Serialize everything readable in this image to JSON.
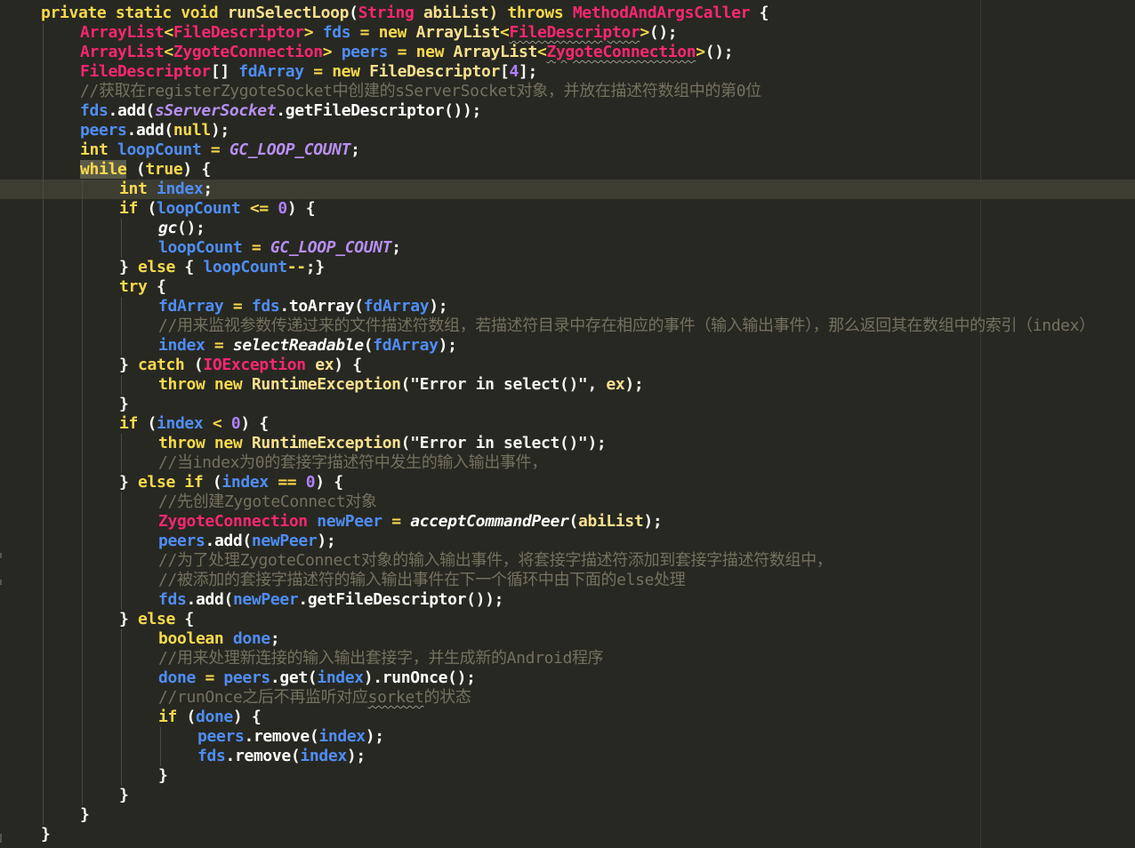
{
  "editor": {
    "current_line_index": 9,
    "lines": [
      {
        "indent": 1,
        "tokens": [
          {
            "t": "private static void ",
            "c": "kw"
          },
          {
            "t": "runSelectLoop",
            "c": "cl"
          },
          {
            "t": "(",
            "c": "pu"
          },
          {
            "t": "String",
            "c": "ty"
          },
          {
            "t": " abiList) ",
            "c": "cl"
          },
          {
            "t": "throws",
            "c": "kw"
          },
          {
            "t": " ",
            "c": "pu"
          },
          {
            "t": "MethodAndArgsCaller",
            "c": "ty"
          },
          {
            "t": " {",
            "c": "pu"
          }
        ]
      },
      {
        "indent": 2,
        "tokens": [
          {
            "t": "ArrayList",
            "c": "ty"
          },
          {
            "t": "<",
            "c": "op"
          },
          {
            "t": "FileDescriptor",
            "c": "ty"
          },
          {
            "t": ">",
            "c": "op"
          },
          {
            "t": " ",
            "c": "pu"
          },
          {
            "t": "fds",
            "c": "va"
          },
          {
            "t": " = ",
            "c": "op"
          },
          {
            "t": "new ",
            "c": "kw"
          },
          {
            "t": "ArrayList",
            "c": "cl"
          },
          {
            "t": "<",
            "c": "op"
          },
          {
            "t": "FileDescriptor",
            "c": "ty",
            "sq": true
          },
          {
            "t": ">",
            "c": "op"
          },
          {
            "t": "();",
            "c": "pu"
          }
        ]
      },
      {
        "indent": 2,
        "tokens": [
          {
            "t": "ArrayList",
            "c": "ty"
          },
          {
            "t": "<",
            "c": "op"
          },
          {
            "t": "ZygoteConnection",
            "c": "ty"
          },
          {
            "t": ">",
            "c": "op"
          },
          {
            "t": " ",
            "c": "pu"
          },
          {
            "t": "peers",
            "c": "va"
          },
          {
            "t": " = ",
            "c": "op"
          },
          {
            "t": "new ",
            "c": "kw"
          },
          {
            "t": "ArrayList",
            "c": "cl"
          },
          {
            "t": "<",
            "c": "op"
          },
          {
            "t": "ZygoteConnection",
            "c": "ty",
            "sq": true
          },
          {
            "t": ">",
            "c": "op"
          },
          {
            "t": "();",
            "c": "pu"
          }
        ]
      },
      {
        "indent": 2,
        "tokens": [
          {
            "t": "FileDescriptor",
            "c": "ty"
          },
          {
            "t": "[] ",
            "c": "pu"
          },
          {
            "t": "fdArray",
            "c": "va"
          },
          {
            "t": " = ",
            "c": "op"
          },
          {
            "t": "new ",
            "c": "kw"
          },
          {
            "t": "FileDescriptor",
            "c": "cl"
          },
          {
            "t": "[",
            "c": "pu"
          },
          {
            "t": "4",
            "c": "nu"
          },
          {
            "t": "];",
            "c": "pu"
          }
        ]
      },
      {
        "indent": 2,
        "tokens": [
          {
            "t": "//获取在registerZygoteSocket中创建的sServerSocket对象，并放在描述符数组中的第0位",
            "c": "co"
          }
        ]
      },
      {
        "indent": 2,
        "tokens": [
          {
            "t": "fds",
            "c": "va"
          },
          {
            "t": ".",
            "c": "pu"
          },
          {
            "t": "add",
            "c": "fn"
          },
          {
            "t": "(",
            "c": "pu"
          },
          {
            "t": "sServerSocket",
            "c": "ss"
          },
          {
            "t": ".",
            "c": "pu"
          },
          {
            "t": "getFileDescriptor",
            "c": "fn"
          },
          {
            "t": "());",
            "c": "pu"
          }
        ]
      },
      {
        "indent": 2,
        "tokens": [
          {
            "t": "peers",
            "c": "va"
          },
          {
            "t": ".",
            "c": "pu"
          },
          {
            "t": "add",
            "c": "fn"
          },
          {
            "t": "(",
            "c": "pu"
          },
          {
            "t": "null",
            "c": "kw"
          },
          {
            "t": ");",
            "c": "pu"
          }
        ]
      },
      {
        "indent": 2,
        "tokens": [
          {
            "t": "int ",
            "c": "kw"
          },
          {
            "t": "loopCount",
            "c": "va"
          },
          {
            "t": " = ",
            "c": "op"
          },
          {
            "t": "GC_LOOP_COUNT",
            "c": "ss"
          },
          {
            "t": ";",
            "c": "pu"
          }
        ]
      },
      {
        "indent": 2,
        "tokens": [
          {
            "t": "while",
            "c": "kw",
            "hl": true
          },
          {
            "t": " (",
            "c": "pu"
          },
          {
            "t": "true",
            "c": "kw"
          },
          {
            "t": ") {",
            "c": "pu"
          }
        ]
      },
      {
        "indent": 3,
        "tokens": [
          {
            "t": "int ",
            "c": "kw"
          },
          {
            "t": "index",
            "c": "va"
          },
          {
            "t": ";",
            "c": "pu"
          }
        ]
      },
      {
        "indent": 3,
        "tokens": [
          {
            "t": "if",
            "c": "kw"
          },
          {
            "t": " (",
            "c": "pu"
          },
          {
            "t": "loopCount",
            "c": "va"
          },
          {
            "t": " <= ",
            "c": "op"
          },
          {
            "t": "0",
            "c": "nu"
          },
          {
            "t": ") {",
            "c": "pu"
          }
        ]
      },
      {
        "indent": 4,
        "tokens": [
          {
            "t": "gc",
            "c": "fn",
            "it": true
          },
          {
            "t": "();",
            "c": "pu"
          }
        ]
      },
      {
        "indent": 4,
        "tokens": [
          {
            "t": "loopCount",
            "c": "va"
          },
          {
            "t": " = ",
            "c": "op"
          },
          {
            "t": "GC_LOOP_COUNT",
            "c": "ss"
          },
          {
            "t": ";",
            "c": "pu"
          }
        ]
      },
      {
        "indent": 3,
        "tokens": [
          {
            "t": "} ",
            "c": "pu"
          },
          {
            "t": "else",
            "c": "kw"
          },
          {
            "t": " { ",
            "c": "pu"
          },
          {
            "t": "loopCount",
            "c": "va"
          },
          {
            "t": "--",
            "c": "op"
          },
          {
            "t": ";}",
            "c": "pu"
          }
        ]
      },
      {
        "indent": 3,
        "tokens": [
          {
            "t": "try",
            "c": "kw"
          },
          {
            "t": " {",
            "c": "pu"
          }
        ]
      },
      {
        "indent": 4,
        "tokens": [
          {
            "t": "fdArray",
            "c": "va"
          },
          {
            "t": " = ",
            "c": "op"
          },
          {
            "t": "fds",
            "c": "va"
          },
          {
            "t": ".",
            "c": "pu"
          },
          {
            "t": "toArray",
            "c": "fn"
          },
          {
            "t": "(",
            "c": "pu"
          },
          {
            "t": "fdArray",
            "c": "va"
          },
          {
            "t": ");",
            "c": "pu"
          }
        ]
      },
      {
        "indent": 4,
        "tokens": [
          {
            "t": "//用来监视参数传递过来的文件描述符数组，若描述符目录中存在相应的事件（输入输出事件），那么返回其在数组中的索引（index）",
            "c": "co"
          }
        ]
      },
      {
        "indent": 4,
        "tokens": [
          {
            "t": "index",
            "c": "va"
          },
          {
            "t": " = ",
            "c": "op"
          },
          {
            "t": "selectReadable",
            "c": "fn",
            "it": true
          },
          {
            "t": "(",
            "c": "pu"
          },
          {
            "t": "fdArray",
            "c": "va"
          },
          {
            "t": ");",
            "c": "pu"
          }
        ]
      },
      {
        "indent": 3,
        "tokens": [
          {
            "t": "} ",
            "c": "pu"
          },
          {
            "t": "catch",
            "c": "kw"
          },
          {
            "t": " (",
            "c": "pu"
          },
          {
            "t": "IOException",
            "c": "ty"
          },
          {
            "t": " ",
            "c": "pu"
          },
          {
            "t": "ex",
            "c": "cl"
          },
          {
            "t": ") {",
            "c": "pu"
          }
        ]
      },
      {
        "indent": 4,
        "tokens": [
          {
            "t": "throw new ",
            "c": "kw"
          },
          {
            "t": "RuntimeException",
            "c": "cl"
          },
          {
            "t": "(",
            "c": "pu"
          },
          {
            "t": "\"Error in select()\"",
            "c": "st"
          },
          {
            "t": ", ",
            "c": "pu"
          },
          {
            "t": "ex",
            "c": "cl"
          },
          {
            "t": ");",
            "c": "pu"
          }
        ]
      },
      {
        "indent": 3,
        "tokens": [
          {
            "t": "}",
            "c": "pu"
          }
        ]
      },
      {
        "indent": 3,
        "tokens": [
          {
            "t": "if",
            "c": "kw"
          },
          {
            "t": " (",
            "c": "pu"
          },
          {
            "t": "index",
            "c": "va"
          },
          {
            "t": " < ",
            "c": "op"
          },
          {
            "t": "0",
            "c": "nu"
          },
          {
            "t": ") {",
            "c": "pu"
          }
        ]
      },
      {
        "indent": 4,
        "tokens": [
          {
            "t": "throw new ",
            "c": "kw"
          },
          {
            "t": "RuntimeException",
            "c": "cl"
          },
          {
            "t": "(",
            "c": "pu"
          },
          {
            "t": "\"Error in select()\"",
            "c": "st"
          },
          {
            "t": ");",
            "c": "pu"
          }
        ]
      },
      {
        "indent": 4,
        "tokens": [
          {
            "t": "//当index为0的套接字描述符中发生的输入输出事件，",
            "c": "co"
          }
        ]
      },
      {
        "indent": 3,
        "tokens": [
          {
            "t": "} ",
            "c": "pu"
          },
          {
            "t": "else if",
            "c": "kw"
          },
          {
            "t": " (",
            "c": "pu"
          },
          {
            "t": "index",
            "c": "va"
          },
          {
            "t": " == ",
            "c": "op"
          },
          {
            "t": "0",
            "c": "nu"
          },
          {
            "t": ") {",
            "c": "pu"
          }
        ]
      },
      {
        "indent": 4,
        "tokens": [
          {
            "t": "//先创建ZygoteConnect对象",
            "c": "co"
          }
        ]
      },
      {
        "indent": 4,
        "tokens": [
          {
            "t": "ZygoteConnection",
            "c": "ty"
          },
          {
            "t": " ",
            "c": "pu"
          },
          {
            "t": "newPeer",
            "c": "va"
          },
          {
            "t": " = ",
            "c": "op"
          },
          {
            "t": "acceptCommandPeer",
            "c": "fn",
            "it": true
          },
          {
            "t": "(",
            "c": "pu"
          },
          {
            "t": "abiList",
            "c": "cl"
          },
          {
            "t": ");",
            "c": "pu"
          }
        ]
      },
      {
        "indent": 4,
        "tokens": [
          {
            "t": "peers",
            "c": "va"
          },
          {
            "t": ".",
            "c": "pu"
          },
          {
            "t": "add",
            "c": "fn"
          },
          {
            "t": "(",
            "c": "pu"
          },
          {
            "t": "newPeer",
            "c": "va"
          },
          {
            "t": ");",
            "c": "pu"
          }
        ]
      },
      {
        "indent": 4,
        "tokens": [
          {
            "t": "//为了处理ZygoteConnect对象的输入输出事件，将套接字描述符添加到套接字描述符数组中，",
            "c": "co"
          }
        ]
      },
      {
        "indent": 4,
        "tokens": [
          {
            "t": "//被添加的套接字描述符的输入输出事件在下一个循环中由下面的else处理",
            "c": "co"
          }
        ]
      },
      {
        "indent": 4,
        "tokens": [
          {
            "t": "fds",
            "c": "va"
          },
          {
            "t": ".",
            "c": "pu"
          },
          {
            "t": "add",
            "c": "fn"
          },
          {
            "t": "(",
            "c": "pu"
          },
          {
            "t": "newPeer",
            "c": "va"
          },
          {
            "t": ".",
            "c": "pu"
          },
          {
            "t": "getFileDescriptor",
            "c": "fn"
          },
          {
            "t": "());",
            "c": "pu"
          }
        ]
      },
      {
        "indent": 3,
        "tokens": [
          {
            "t": "} ",
            "c": "pu"
          },
          {
            "t": "else",
            "c": "kw"
          },
          {
            "t": " {",
            "c": "pu"
          }
        ]
      },
      {
        "indent": 4,
        "tokens": [
          {
            "t": "boolean ",
            "c": "kw"
          },
          {
            "t": "done",
            "c": "va"
          },
          {
            "t": ";",
            "c": "pu"
          }
        ]
      },
      {
        "indent": 4,
        "tokens": [
          {
            "t": "//用来处理新连接的输入输出套接字，并生成新的Android程序",
            "c": "co"
          }
        ]
      },
      {
        "indent": 4,
        "tokens": [
          {
            "t": "done",
            "c": "va"
          },
          {
            "t": " = ",
            "c": "op"
          },
          {
            "t": "peers",
            "c": "va"
          },
          {
            "t": ".",
            "c": "pu"
          },
          {
            "t": "get",
            "c": "fn"
          },
          {
            "t": "(",
            "c": "pu"
          },
          {
            "t": "index",
            "c": "va"
          },
          {
            "t": ").",
            "c": "pu"
          },
          {
            "t": "runOnce",
            "c": "fn"
          },
          {
            "t": "();",
            "c": "pu"
          }
        ]
      },
      {
        "indent": 4,
        "tokens": [
          {
            "t": "//runOnce之后不再监听对应",
            "c": "co"
          },
          {
            "t": "sorket",
            "c": "co",
            "sq": true
          },
          {
            "t": "的状态",
            "c": "co"
          }
        ]
      },
      {
        "indent": 4,
        "tokens": [
          {
            "t": "if",
            "c": "kw"
          },
          {
            "t": " (",
            "c": "pu"
          },
          {
            "t": "done",
            "c": "va"
          },
          {
            "t": ") {",
            "c": "pu"
          }
        ]
      },
      {
        "indent": 5,
        "tokens": [
          {
            "t": "peers",
            "c": "va"
          },
          {
            "t": ".",
            "c": "pu"
          },
          {
            "t": "remove",
            "c": "fn"
          },
          {
            "t": "(",
            "c": "pu"
          },
          {
            "t": "index",
            "c": "va"
          },
          {
            "t": ");",
            "c": "pu"
          }
        ]
      },
      {
        "indent": 5,
        "tokens": [
          {
            "t": "fds",
            "c": "va"
          },
          {
            "t": ".",
            "c": "pu"
          },
          {
            "t": "remove",
            "c": "fn"
          },
          {
            "t": "(",
            "c": "pu"
          },
          {
            "t": "index",
            "c": "va"
          },
          {
            "t": ");",
            "c": "pu"
          }
        ]
      },
      {
        "indent": 4,
        "tokens": [
          {
            "t": "}",
            "c": "pu"
          }
        ]
      },
      {
        "indent": 3,
        "tokens": [
          {
            "t": "}",
            "c": "pu"
          }
        ]
      },
      {
        "indent": 2,
        "tokens": [
          {
            "t": "}",
            "c": "pu"
          }
        ]
      },
      {
        "indent": 1,
        "tokens": [
          {
            "t": "}",
            "c": "pu"
          }
        ]
      }
    ]
  },
  "colors": {
    "background": "#272822",
    "current_line": "#3E3D32",
    "keyword": "#F8D94C",
    "type": "#F92672",
    "variable": "#4F8DF5",
    "static_field": "#B78FF0",
    "comment": "#75715E",
    "number": "#AE81FF"
  }
}
